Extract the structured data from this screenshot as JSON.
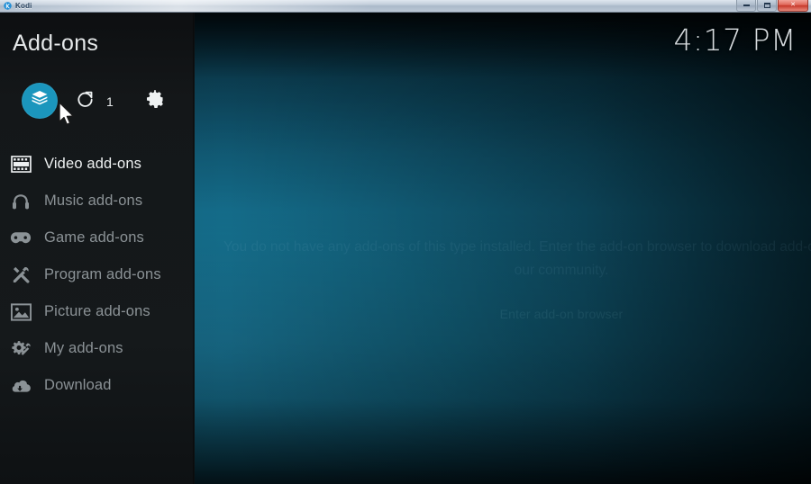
{
  "window": {
    "app_title": "Kodi",
    "app_icon": "kodi-logo-icon",
    "minimize_label": "–",
    "maximize_label": "□",
    "close_label": "✕"
  },
  "header": {
    "page_title": "Add-ons",
    "clock": "4:17 PM"
  },
  "toolbar": {
    "addon_browser": {
      "icon": "package-box-icon",
      "label": "",
      "accent": "#1b96bd"
    },
    "updates": {
      "icon": "refresh-circle-arrow-icon",
      "count": "1"
    },
    "settings": {
      "icon": "gear-icon"
    }
  },
  "sidebar": {
    "items": [
      {
        "label": "Video add-ons",
        "icon": "film-strip-icon",
        "selected": true
      },
      {
        "label": "Music add-ons",
        "icon": "headphones-icon",
        "selected": false
      },
      {
        "label": "Game add-ons",
        "icon": "gamepad-icon",
        "selected": false
      },
      {
        "label": "Program add-ons",
        "icon": "crossed-tools-icon",
        "selected": false
      },
      {
        "label": "Picture add-ons",
        "icon": "picture-image-icon",
        "selected": false
      },
      {
        "label": "My add-ons",
        "icon": "gear-wrench-icon",
        "selected": false
      },
      {
        "label": "Download",
        "icon": "cloud-download-icon",
        "selected": false
      }
    ]
  },
  "main": {
    "empty_message": "You do not have any add-ons of this type installed. Enter the add-on browser to download add-ons created by our community.",
    "empty_button": "Enter add-on browser"
  },
  "colors": {
    "accent": "#1b96bd",
    "sidebar_bg": "#141719",
    "background_teal": "#0f5570",
    "text_primary": "#eef1f2",
    "text_muted": "#8b9296"
  }
}
